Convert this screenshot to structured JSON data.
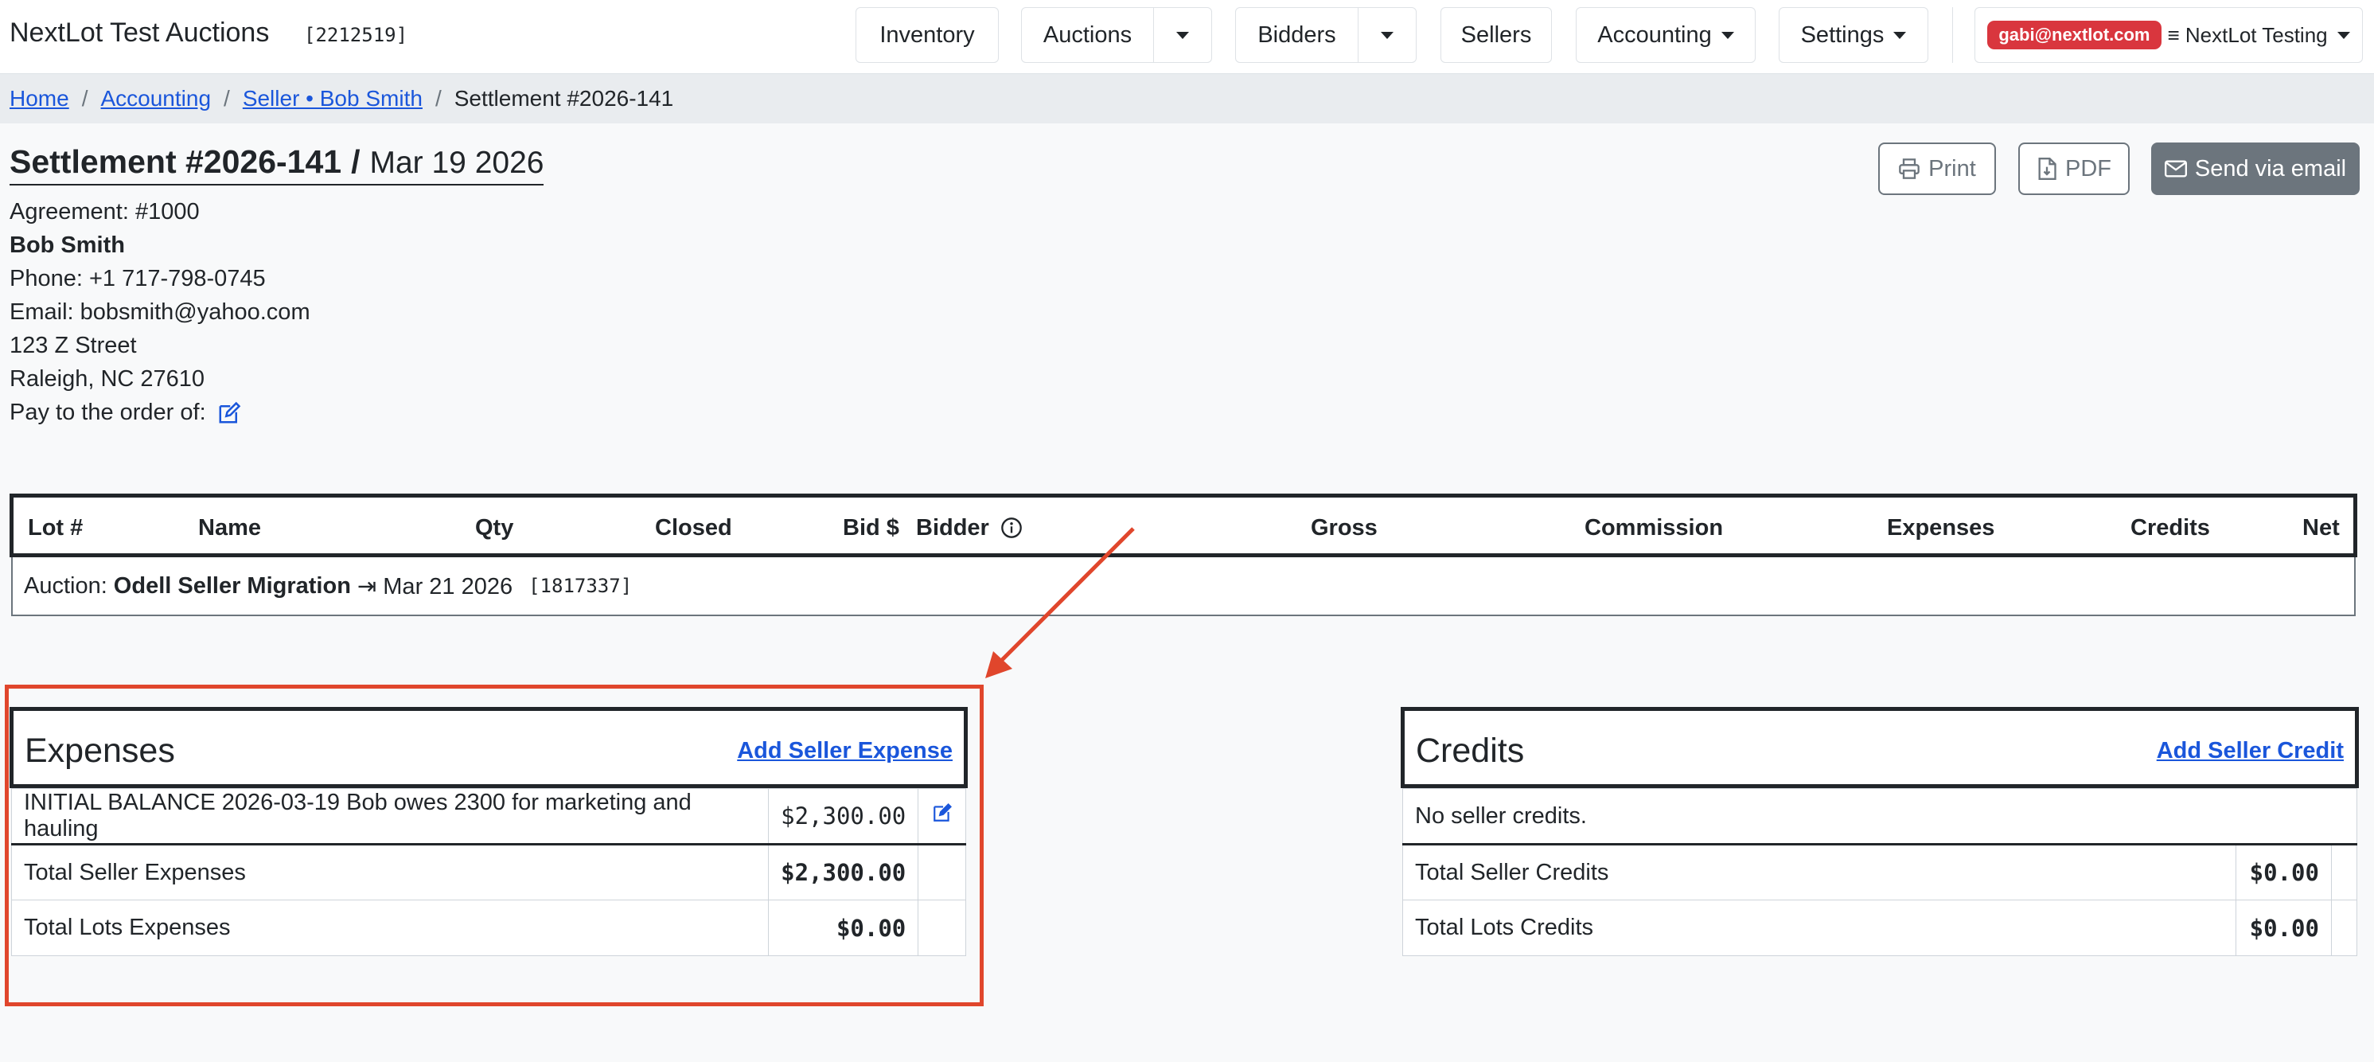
{
  "nav": {
    "brand": "NextLot Test Auctions",
    "brand_id": "[2212519]",
    "inventory": "Inventory",
    "auctions": "Auctions",
    "bidders": "Bidders",
    "sellers": "Sellers",
    "accounting": "Accounting",
    "settings": "Settings",
    "user_email": "gabi@nextlot.com",
    "org": "≡ NextLot Testing"
  },
  "breadcrumb": {
    "home": "Home",
    "accounting": "Accounting",
    "seller": "Seller • Bob Smith",
    "current": "Settlement #2026-141",
    "sep": "/"
  },
  "header": {
    "settlement": "Settlement #2026-141",
    "slash": "/",
    "date": "Mar 19 2026",
    "print": "Print",
    "pdf": "PDF",
    "send": "Send via email"
  },
  "seller": {
    "agreement": "Agreement: #1000",
    "name": "Bob Smith",
    "phone": "Phone: +1 717-798-0745",
    "email": "Email: bobsmith@yahoo.com",
    "street": "123 Z Street",
    "city": "Raleigh, NC 27610",
    "pay_to": "Pay to the order of:"
  },
  "lots_table": {
    "columns": [
      "Lot #",
      "Name",
      "Qty",
      "Closed",
      "Bid $",
      "Bidder",
      "Gross",
      "Commission",
      "Expenses",
      "Credits",
      "Net"
    ],
    "auction_prefix": "Auction:",
    "auction_name": "Odell Seller Migration",
    "auction_date": "⇥ Mar 21 2026",
    "auction_id": "[1817337]"
  },
  "expenses": {
    "title": "Expenses",
    "add_link": "Add Seller Expense",
    "rows": [
      {
        "label": "INITIAL BALANCE 2026-03-19 Bob owes 2300 for marketing and hauling",
        "amount": "$2,300.00"
      }
    ],
    "total_seller_label": "Total Seller Expenses",
    "total_seller_amount": "$2,300.00",
    "total_lots_label": "Total Lots Expenses",
    "total_lots_amount": "$0.00"
  },
  "credits": {
    "title": "Credits",
    "add_link": "Add Seller Credit",
    "empty": "No seller credits.",
    "total_seller_label": "Total Seller Credits",
    "total_seller_amount": "$0.00",
    "total_lots_label": "Total Lots Credits",
    "total_lots_amount": "$0.00"
  },
  "colors": {
    "link": "#1a56db",
    "annotation": "#e0462c",
    "user_badge": "#d9363e",
    "secondary": "#6c757d"
  }
}
